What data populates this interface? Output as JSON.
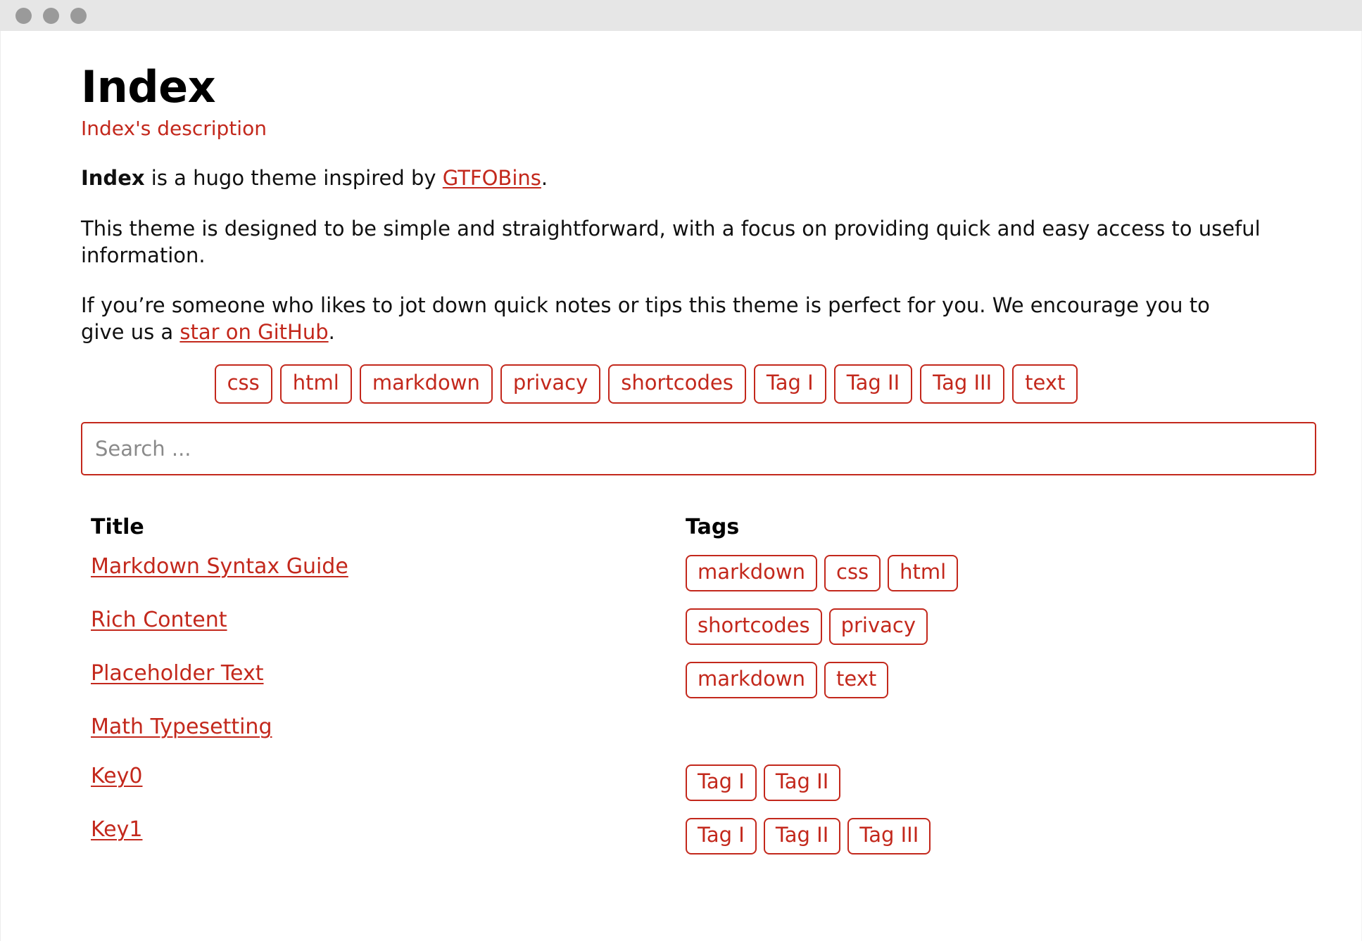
{
  "window": {
    "dots": [
      "close-dot",
      "minimize-dot",
      "maximize-dot"
    ]
  },
  "colors": {
    "accent": "#C3281C",
    "text": "#101010",
    "titlebar": "#E6E6E6",
    "dot": "#9A9A9A",
    "placeholder": "#8A8A8A"
  },
  "header": {
    "title": "Index",
    "description": "Index's description"
  },
  "intro": {
    "p1_bold": "Index",
    "p1_mid": " is a hugo theme inspired by ",
    "p1_link": "GTFOBins",
    "p1_end": ".",
    "p2": "This theme is designed to be simple and straightforward, with a focus on providing quick and easy access to useful information.",
    "p3_start": "If you’re someone who likes to jot down quick notes or tips this theme is perfect for you. We encourage you to give us a ",
    "p3_link": "star on GitHub",
    "p3_end": "."
  },
  "tag_filters": [
    "css",
    "html",
    "markdown",
    "privacy",
    "shortcodes",
    "Tag I",
    "Tag II",
    "Tag III",
    "text"
  ],
  "search": {
    "value": "",
    "placeholder": "Search ..."
  },
  "table": {
    "headers": {
      "title": "Title",
      "tags": "Tags"
    },
    "rows": [
      {
        "title": "Markdown Syntax Guide",
        "tags": [
          "markdown",
          "css",
          "html"
        ]
      },
      {
        "title": "Rich Content",
        "tags": [
          "shortcodes",
          "privacy"
        ]
      },
      {
        "title": "Placeholder Text",
        "tags": [
          "markdown",
          "text"
        ]
      },
      {
        "title": "Math Typesetting",
        "tags": []
      },
      {
        "title": "Key0",
        "tags": [
          "Tag I",
          "Tag II"
        ]
      },
      {
        "title": "Key1",
        "tags": [
          "Tag I",
          "Tag II",
          "Tag III"
        ]
      }
    ]
  }
}
